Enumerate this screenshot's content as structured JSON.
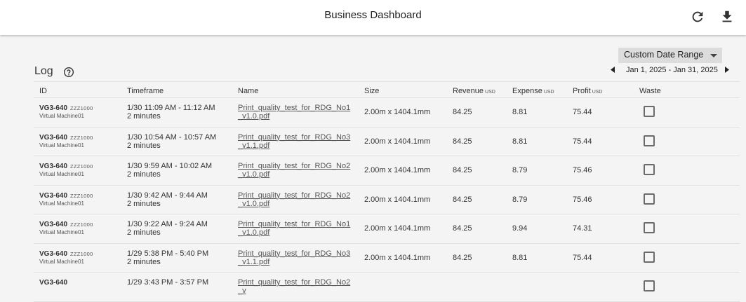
{
  "header": {
    "title": "Business Dashboard"
  },
  "icons": {
    "refresh": "refresh-icon",
    "download": "download-icon",
    "help": "help-icon"
  },
  "log": {
    "title": "Log"
  },
  "date_range": {
    "select_label": "Custom Date Range",
    "range_text": "Jan 1, 2025 - Jan 31, 2025"
  },
  "table": {
    "columns": {
      "id": "ID",
      "timeframe": "Timeframe",
      "name": "Name",
      "size": "Size",
      "revenue": "Revenue",
      "revenue_unit": "USD",
      "expense": "Expense",
      "expense_unit": "USD",
      "profit": "Profit",
      "profit_unit": "USD",
      "waste": "Waste"
    },
    "rows": [
      {
        "id": "VG3-640",
        "code": "ZZZ1000",
        "machine": "Virtual Machine01",
        "time": "1/30 11:09 AM - 11:12 AM",
        "duration": "2 minutes",
        "name": "Print_quality_test_for_RDG_No1_v1.0.pdf",
        "size": "2.00m x 1404.1mm",
        "revenue": "84.25",
        "expense": "8.81",
        "profit": "75.44",
        "waste": false
      },
      {
        "id": "VG3-640",
        "code": "ZZZ1000",
        "machine": "Virtual Machine01",
        "time": "1/30 10:54 AM - 10:57 AM",
        "duration": "2 minutes",
        "name": "Print_quality_test_for_RDG_No3_v1.1.pdf",
        "size": "2.00m x 1404.1mm",
        "revenue": "84.25",
        "expense": "8.81",
        "profit": "75.44",
        "waste": false
      },
      {
        "id": "VG3-640",
        "code": "ZZZ1000",
        "machine": "Virtual Machine01",
        "time": "1/30 9:59 AM - 10:02 AM",
        "duration": "2 minutes",
        "name": "Print_quality_test_for_RDG_No2_v1.0.pdf",
        "size": "2.00m x 1404.1mm",
        "revenue": "84.25",
        "expense": "8.79",
        "profit": "75.46",
        "waste": false
      },
      {
        "id": "VG3-640",
        "code": "ZZZ1000",
        "machine": "Virtual Machine01",
        "time": "1/30 9:42 AM - 9:44 AM",
        "duration": "2 minutes",
        "name": "Print_quality_test_for_RDG_No2_v1.0.pdf",
        "size": "2.00m x 1404.1mm",
        "revenue": "84.25",
        "expense": "8.79",
        "profit": "75.46",
        "waste": false
      },
      {
        "id": "VG3-640",
        "code": "ZZZ1000",
        "machine": "Virtual Machine01",
        "time": "1/30 9:22 AM - 9:24 AM",
        "duration": "2 minutes",
        "name": "Print_quality_test_for_RDG_No1_v1.0.pdf",
        "size": "2.00m x 1404.1mm",
        "revenue": "84.25",
        "expense": "9.94",
        "profit": "74.31",
        "waste": false
      },
      {
        "id": "VG3-640",
        "code": "ZZZ1000",
        "machine": "Virtual Machine01",
        "time": "1/29 5:38 PM - 5:40 PM",
        "duration": "2 minutes",
        "name": "Print_quality_test_for_RDG_No3_v1.1.pdf",
        "size": "2.00m x 1404.1mm",
        "revenue": "84.25",
        "expense": "8.81",
        "profit": "75.44",
        "waste": false
      },
      {
        "id": "VG3-640",
        "code": "",
        "machine": "",
        "time": "1/29 3:43 PM - 3:57 PM",
        "duration": "",
        "name": "Print_quality_test_for_RDG_No2_v",
        "size": "",
        "revenue": "",
        "expense": "",
        "profit": "",
        "waste": false
      }
    ]
  }
}
